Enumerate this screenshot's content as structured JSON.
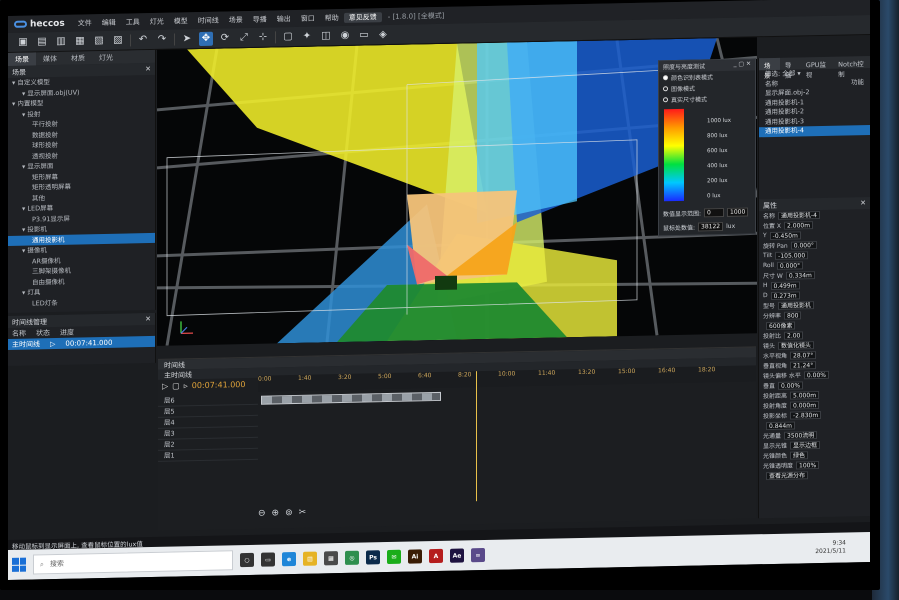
{
  "app": {
    "logo_text": "heccos",
    "version": "- [1.8.0] [全模式]"
  },
  "menu": [
    "文件",
    "编辑",
    "工具",
    "灯光",
    "模型",
    "时间线",
    "场景",
    "导播",
    "输出",
    "窗口",
    "帮助"
  ],
  "active_menu": "意见反馈",
  "toolbar_icons": [
    "new-icon",
    "open-icon",
    "save-icon",
    "save-as-icon",
    "import-icon",
    "export-icon",
    "undo-icon",
    "redo-icon",
    "select-icon",
    "move-icon",
    "rotate-icon",
    "scale-icon",
    "axis-icon",
    "cube-icon",
    "light-icon",
    "projector-icon",
    "camera-icon",
    "screen-icon",
    "render-icon"
  ],
  "left_panel": {
    "tabs": [
      "场景",
      "媒体",
      "材质",
      "灯光"
    ],
    "header": "场景",
    "tree": [
      {
        "label": "自定义模型",
        "depth": 0
      },
      {
        "label": "显示屏面.obj(UV)",
        "depth": 1
      },
      {
        "label": "内置模型",
        "depth": 0
      },
      {
        "label": "投射",
        "depth": 1
      },
      {
        "label": "平行投射",
        "depth": 2
      },
      {
        "label": "数据投射",
        "depth": 2
      },
      {
        "label": "球形投射",
        "depth": 2
      },
      {
        "label": "透视投射",
        "depth": 2
      },
      {
        "label": "显示屏面",
        "depth": 1
      },
      {
        "label": "矩形屏幕",
        "depth": 2
      },
      {
        "label": "矩形透明屏幕",
        "depth": 2
      },
      {
        "label": "其他",
        "depth": 2
      },
      {
        "label": "LED屏幕",
        "depth": 1
      },
      {
        "label": "P3.91显示屏",
        "depth": 2
      },
      {
        "label": "投影机",
        "depth": 1
      },
      {
        "label": "通用投影机",
        "depth": 2,
        "selected": true
      },
      {
        "label": "摄像机",
        "depth": 1
      },
      {
        "label": "AR摄像机",
        "depth": 2
      },
      {
        "label": "三脚架摄像机",
        "depth": 2
      },
      {
        "label": "自由摄像机",
        "depth": 2
      },
      {
        "label": "灯具",
        "depth": 1
      },
      {
        "label": "LED灯条",
        "depth": 2
      }
    ]
  },
  "timeline_manager": {
    "title": "时间线管理",
    "columns": [
      "名称",
      "状态",
      "进度"
    ],
    "rows": [
      {
        "name": "主时间线",
        "progress": "00:07:41.000"
      }
    ]
  },
  "overlay": {
    "title": "照度与亮度测试",
    "options": [
      "颜色识别表模式",
      "图像模式",
      "真实尺寸模式"
    ],
    "scale_labels": [
      "1000 lux",
      "800 lux",
      "600 lux",
      "400 lux",
      "200 lux",
      "0 lux"
    ],
    "range_label": "数值显示范围:",
    "range_min": "0",
    "range_max": "1000",
    "value_label": "鼠标处数值:",
    "value": "38122",
    "value_unit": "lux"
  },
  "right_panel": {
    "tabs": [
      "场景",
      "导播",
      "GPU监视",
      "Notch控制"
    ],
    "filter": "全部",
    "col_name": "名称",
    "col_func": "功能",
    "objects": [
      {
        "name": "显示屏面.obj-2"
      },
      {
        "name": "通用投影机-1"
      },
      {
        "name": "通用投影机-2"
      },
      {
        "name": "通用投影机-3"
      },
      {
        "name": "通用投影机-4",
        "selected": true
      }
    ],
    "props_title": "属性",
    "props": [
      {
        "label": "名称",
        "value": "通用投影机-4"
      },
      {
        "label": "位置 X",
        "value": "2.000m"
      },
      {
        "label": "Y",
        "value": "-0.450m"
      },
      {
        "label": "旋转 Pan",
        "value": "0.000°"
      },
      {
        "label": "Tilt",
        "value": "-105.000"
      },
      {
        "label": "Roll",
        "value": "0.000°"
      },
      {
        "label": "尺寸 W",
        "value": "0.334m"
      },
      {
        "label": "H",
        "value": "0.499m"
      },
      {
        "label": "D",
        "value": "0.273m"
      },
      {
        "label": "型号",
        "value": "通用投影机"
      },
      {
        "label": "分辨率",
        "value": "800"
      },
      {
        "label": "",
        "value": "600像素"
      },
      {
        "label": "投射比",
        "value": "2.00"
      },
      {
        "label": "镜头",
        "value": "数值化镜头"
      },
      {
        "label": "水平视角",
        "value": "28.07°"
      },
      {
        "label": "垂直视角",
        "value": "21.24°"
      },
      {
        "label": "镜头偏移 水平",
        "value": "0.00%"
      },
      {
        "label": "垂直",
        "value": "0.00%"
      },
      {
        "label": "投射距离",
        "value": "5.000m"
      },
      {
        "label": "投射角度",
        "value": "0.000m"
      },
      {
        "label": "投影坐标",
        "value": "-2.830m"
      },
      {
        "label": "",
        "value": "0.844m"
      },
      {
        "label": "光通量",
        "value": "3500流明"
      },
      {
        "label": "显示光锥",
        "value": "显示边框"
      },
      {
        "label": "光锥颜色",
        "value": "绿色"
      },
      {
        "label": "光锥透明度",
        "value": "100%"
      },
      {
        "label": "",
        "value": "查看光源分布"
      }
    ]
  },
  "timeline": {
    "title": "时间线",
    "sub": "主时间线",
    "time": "00:07:41.000",
    "ticks": [
      "0:00",
      "1:40",
      "3:20",
      "5:00",
      "6:40",
      "8:20",
      "10:00",
      "11:40",
      "13:20",
      "15:00",
      "16:40",
      "18:20"
    ],
    "layers": [
      "层6",
      "层5",
      "层4",
      "层3",
      "层2",
      "层1"
    ]
  },
  "status_bar": "移动鼠标到显示屏面上, 查看鼠标位置的lux值",
  "taskbar": {
    "search_placeholder": "搜索",
    "apps": [
      {
        "name": "cortana-icon",
        "label": "○",
        "color": "#333333"
      },
      {
        "name": "task-view-icon",
        "label": "▭",
        "color": "#333333"
      },
      {
        "name": "edge-icon",
        "label": "e",
        "color": "#1f86d8"
      },
      {
        "name": "explorer-icon",
        "label": "▤",
        "color": "#e6b325"
      },
      {
        "name": "store-icon",
        "label": "▦",
        "color": "#4a4a4a"
      },
      {
        "name": "chrome-icon",
        "label": "◎",
        "color": "#2f8f4e"
      },
      {
        "name": "photoshop-icon",
        "label": "Ps",
        "color": "#0b2a4a"
      },
      {
        "name": "wechat-icon",
        "label": "✉",
        "color": "#1aad19"
      },
      {
        "name": "illustrator-icon",
        "label": "Ai",
        "color": "#3a1c05"
      },
      {
        "name": "acrobat-icon",
        "label": "A",
        "color": "#b51d1d"
      },
      {
        "name": "aftereffects-icon",
        "label": "Ae",
        "color": "#1e1240"
      },
      {
        "name": "heccos-icon",
        "label": "∞",
        "color": "#5a4a8a"
      }
    ],
    "time": "9:34",
    "date": "2021/5/11"
  }
}
